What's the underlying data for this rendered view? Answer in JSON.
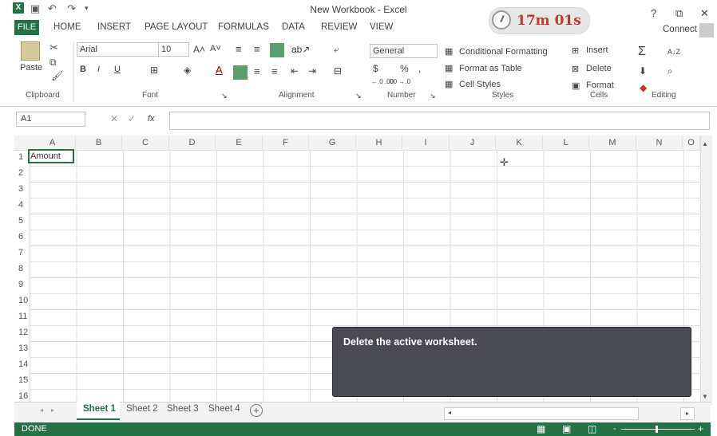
{
  "window": {
    "title": "New Workbook - Excel",
    "help": "?",
    "restore": "⧉",
    "close": "✕",
    "connect": "Connect"
  },
  "timer": {
    "value": "17m 01s",
    "color": "#c0392b"
  },
  "ribbon_tabs": [
    "FILE",
    "HOME",
    "INSERT",
    "PAGE LAYOUT",
    "FORMULAS",
    "DATA",
    "REVIEW",
    "VIEW"
  ],
  "clipboard": {
    "paste": "Paste",
    "label": "Clipboard"
  },
  "font": {
    "name": "Arial",
    "size": "10",
    "bold": "B",
    "italic": "I",
    "underline": "U",
    "label": "Font"
  },
  "alignment": {
    "label": "Alignment"
  },
  "number": {
    "format": "General",
    "currency": "$",
    "percent": "%",
    "comma": ",",
    "inc_dec": "←.0 .00",
    "dec_dec": ".00 →.0",
    "label": "Number"
  },
  "styles": {
    "conditional": "Conditional Formatting",
    "table": "Format as Table",
    "cell_styles": "Cell Styles",
    "label": "Styles"
  },
  "cells": {
    "insert": "Insert",
    "delete": "Delete",
    "format": "Format",
    "label": "Cells"
  },
  "editing": {
    "sum": "Σ",
    "sort": "A↓Z",
    "label": "Editing"
  },
  "formula_bar": {
    "name_box": "A1",
    "cancel": "✕",
    "enter": "✓",
    "fx": "fx",
    "value": ""
  },
  "columns": [
    "A",
    "B",
    "C",
    "D",
    "E",
    "F",
    "G",
    "H",
    "I",
    "J",
    "K",
    "L",
    "M",
    "N",
    "O"
  ],
  "rows": [
    "1",
    "2",
    "3",
    "4",
    "5",
    "6",
    "7",
    "8",
    "9",
    "10",
    "11",
    "12",
    "13",
    "14",
    "15",
    "16"
  ],
  "cells_data": {
    "A1": "Amount"
  },
  "sheets": [
    "Sheet 1",
    "Sheet 2",
    "Sheet 3",
    "Sheet 4"
  ],
  "active_sheet": "Sheet 1",
  "status": "DONE",
  "tooltip": "Delete the active worksheet.",
  "colors": {
    "accent": "#217346",
    "tooltip_bg": "#4a4a52"
  }
}
